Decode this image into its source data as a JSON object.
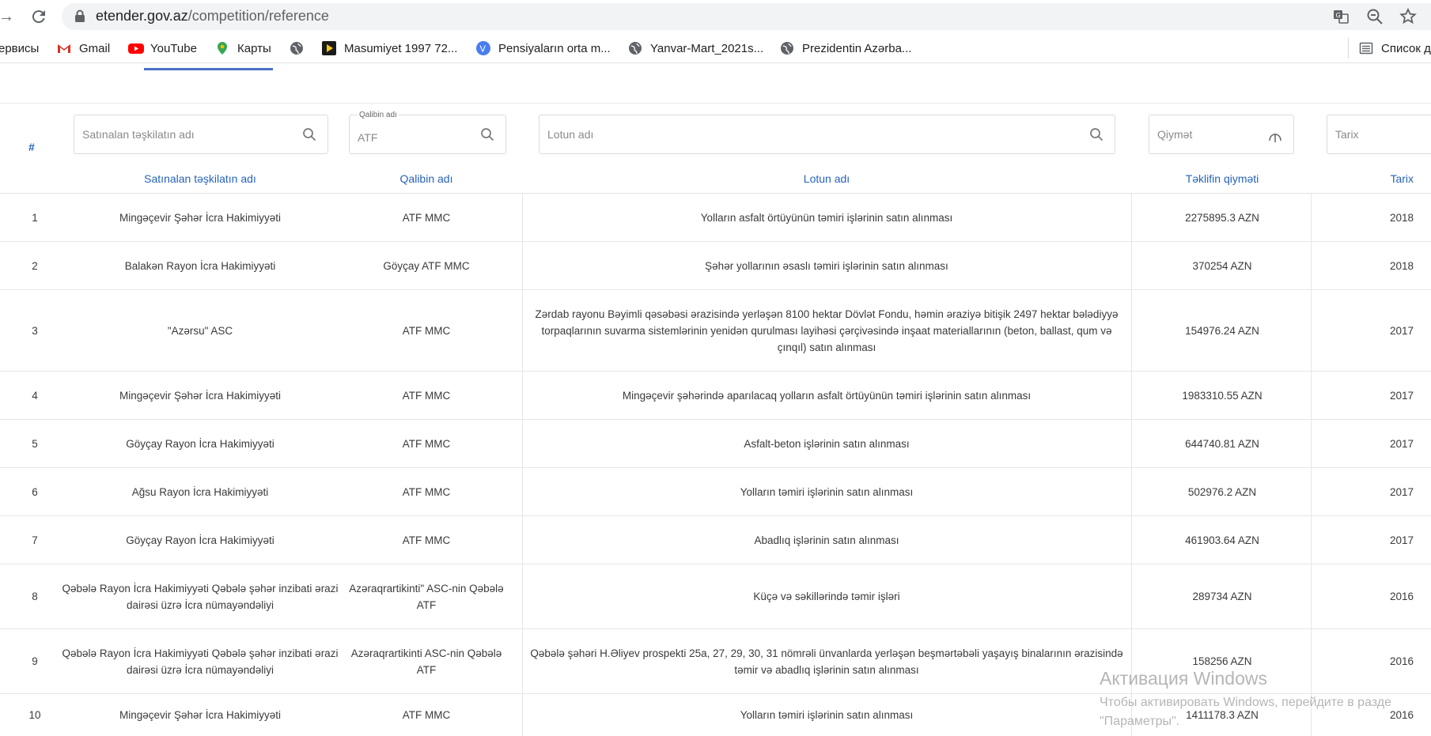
{
  "browser": {
    "url_host": "etender.gov.az",
    "url_path": "/competition/reference",
    "bookmarks": [
      {
        "label": "ервисы",
        "icon": "apps-icon"
      },
      {
        "label": "Gmail",
        "icon": "gmail-icon"
      },
      {
        "label": "YouTube",
        "icon": "youtube-icon"
      },
      {
        "label": "Карты",
        "icon": "maps-icon"
      },
      {
        "label": "",
        "icon": "globe-icon"
      },
      {
        "label": "Masumiyet 1997 72...",
        "icon": "play-icon"
      },
      {
        "label": "Pensiyaların orta m...",
        "icon": "v-icon"
      },
      {
        "label": "Yanvar-Mart_2021s...",
        "icon": "globe-icon"
      },
      {
        "label": "Prezidentin Azərba...",
        "icon": "globe-icon"
      },
      {
        "label": "Список д",
        "icon": "reading-list-icon"
      }
    ]
  },
  "filters": {
    "hash": "#",
    "org_placeholder": "Satınalan təşkilatın adı",
    "template_label": "Qalibin adı",
    "template_value": "ATF",
    "lot_placeholder": "Lotun adı",
    "price_placeholder": "Qiymət",
    "date_placeholder": "Tarix"
  },
  "columns": {
    "org": "Satınalan təşkilatın adı",
    "template": "Qalibin adı",
    "lot": "Lotun adı",
    "price": "Təklifin qiyməti",
    "date": "Tarix"
  },
  "rows": [
    {
      "num": "1",
      "org": "Mingəçevir Şəhər İcra Hakimiyyəti",
      "template": "ATF MMC",
      "lot": "Yolların asfalt örtüyünün təmiri işlərinin satın alınması",
      "price": "2275895.3 AZN",
      "date": "2018"
    },
    {
      "num": "2",
      "org": "Balakən Rayon İcra Hakimiyyəti",
      "template": "Göyçay ATF MMC",
      "lot": "Şəhər yollarının əsaslı təmiri işlərinin satın alınması",
      "price": "370254 AZN",
      "date": "2018"
    },
    {
      "num": "3",
      "org": "\"Azərsu\" ASC",
      "template": "ATF MMC",
      "lot": "Zərdab rayonu Bəyimli qəsəbəsi ərazisində yerləşən 8100 hektar Dövlət Fondu, həmin əraziyə bitişik 2497 hektar bələdiyyə torpaqlarının suvarma sistemlərinin yenidən qurulması layihəsi çərçivəsində inşaat materiallarının (beton, ballast, qum və çınqıl) satın alınması",
      "price": "154976.24 AZN",
      "date": "2017"
    },
    {
      "num": "4",
      "org": "Mingəçevir Şəhər İcra Hakimiyyəti",
      "template": "ATF MMC",
      "lot": "Mingəçevir şəhərində aparılacaq yolların asfalt örtüyünün təmiri işlərinin satın alınması",
      "price": "1983310.55 AZN",
      "date": "2017"
    },
    {
      "num": "5",
      "org": "Göyçay Rayon İcra Hakimiyyəti",
      "template": "ATF MMC",
      "lot": "Asfalt-beton işlərinin satın alınması",
      "price": "644740.81 AZN",
      "date": "2017"
    },
    {
      "num": "6",
      "org": "Ağsu Rayon İcra Hakimiyyəti",
      "template": "ATF MMC",
      "lot": "Yolların təmiri işlərinin satın alınması",
      "price": "502976.2 AZN",
      "date": "2017"
    },
    {
      "num": "7",
      "org": "Göyçay Rayon İcra Hakimiyyəti",
      "template": "ATF MMC",
      "lot": "Abadlıq işlərinin satın alınması",
      "price": "461903.64 AZN",
      "date": "2017"
    },
    {
      "num": "8",
      "org": "Qəbələ Rayon İcra Hakimiyyəti Qəbələ şəhər inzibati ərazi dairəsi üzrə İcra nümayəndəliyi",
      "template": "Azəraqrartikinti\" ASC-nin Qəbələ ATF",
      "lot": "Küçə və səkillərində təmir işləri",
      "price": "289734 AZN",
      "date": "2016"
    },
    {
      "num": "9",
      "org": "Qəbələ Rayon İcra Hakimiyyəti Qəbələ şəhər inzibati ərazi dairəsi üzrə İcra nümayəndəliyi",
      "template": "Azəraqrartikinti ASC-nin Qəbələ ATF",
      "lot": "Qəbələ şəhəri H.Əliyev prospekti 25a, 27, 29, 30, 31 nömrəli ünvanlarda yerləşən beşmərtəbəli yaşayış binalarının ərazisində təmir və abadlıq işlərinin satın alınması",
      "price": "158256 AZN",
      "date": "2016"
    },
    {
      "num": "10",
      "org": "Mingəçevir Şəhər İcra Hakimiyyəti",
      "template": "ATF MMC",
      "lot": "Yolların təmiri işlərinin satın alınması",
      "price": "1411178.3 AZN",
      "date": "2016"
    }
  ],
  "watermark": {
    "title": "Активация Windows",
    "line1": "Чтобы активировать Windows, перейдите в разде",
    "line2": "\"Параметры\"."
  }
}
